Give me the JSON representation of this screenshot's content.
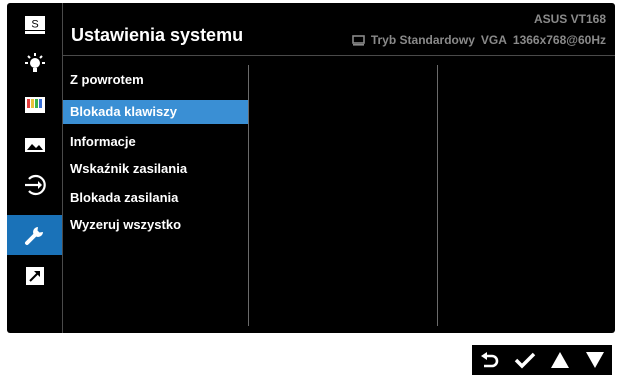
{
  "header": {
    "title": "Ustawienia systemu",
    "model": "ASUS VT168",
    "mode": "Tryb Standardowy",
    "input": "VGA",
    "resolution": "1366x768@60Hz"
  },
  "sidebar": {
    "tabs": [
      {
        "name": "splendid",
        "glyph": "S",
        "icon": "splendid-icon"
      },
      {
        "name": "image",
        "icon": "brightness-icon"
      },
      {
        "name": "color",
        "icon": "color-bars-icon"
      },
      {
        "name": "picture",
        "icon": "picture-icon"
      },
      {
        "name": "input",
        "icon": "input-select-icon"
      },
      {
        "name": "system",
        "icon": "wrench-icon",
        "active": true
      },
      {
        "name": "shortcut",
        "icon": "shortcut-arrow-icon"
      }
    ]
  },
  "menu": {
    "items": [
      {
        "label": "Z powrotem"
      },
      {
        "label": "Blokada klawiszy",
        "selected": true
      },
      {
        "label": "Informacje"
      },
      {
        "label": "Wskaźnik zasilania"
      },
      {
        "label": "Blokada zasilania"
      },
      {
        "label": "Wyzeruj wszystko"
      }
    ]
  },
  "colors": {
    "active_tab": "#1a72b8",
    "selected_item": "#3a8fd4",
    "panel_bg": "#000000",
    "status_text": "#8a8a8a"
  },
  "footer": {
    "buttons": [
      "back-icon",
      "check-icon",
      "up-arrow-icon",
      "down-arrow-icon"
    ]
  }
}
